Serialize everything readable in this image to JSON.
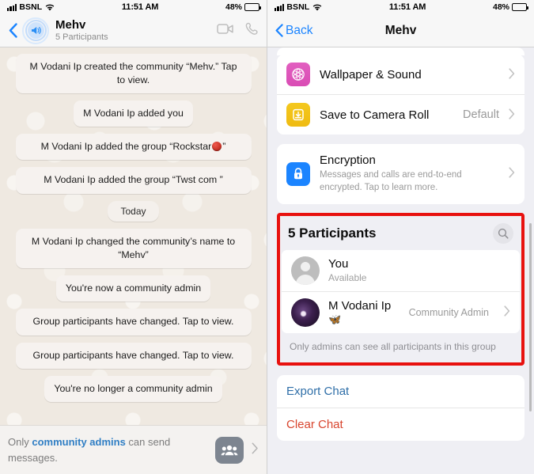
{
  "status_bar": {
    "carrier": "BSNL",
    "time": "11:51 AM",
    "battery_pct": "48%",
    "signal_icon": "signal-bars-icon",
    "wifi_icon": "wifi-icon",
    "battery_icon": "battery-icon"
  },
  "left_panel": {
    "header": {
      "back_icon": "back-chevron-icon",
      "avatar_icon": "community-announcement-icon",
      "title": "Mehv",
      "subtitle": "5 Participants",
      "video_icon": "video-call-icon",
      "phone_icon": "voice-call-icon"
    },
    "messages": [
      {
        "id": "m1",
        "text": "M Vodani Ip created the community “Mehv.” Tap to view.",
        "type": "system",
        "wide": true
      },
      {
        "id": "m2",
        "text": "M Vodani Ip added you",
        "type": "system",
        "wide": false
      },
      {
        "id": "m3",
        "text": "M Vodani Ip added the group “Rockstar",
        "text_after": "”",
        "type": "system-emoji",
        "emoji": "red-circle-emoji",
        "wide": true
      },
      {
        "id": "m4",
        "text": "M Vodani Ip added the group “Twst com ”",
        "type": "system",
        "wide": true
      },
      {
        "id": "d1",
        "text": "Today",
        "type": "day-divider",
        "wide": false
      },
      {
        "id": "m5",
        "text": "M Vodani Ip changed the community’s name to “Mehv”",
        "type": "system",
        "wide": true
      },
      {
        "id": "m6",
        "text": "You're now a community admin",
        "type": "system",
        "wide": false
      },
      {
        "id": "m7",
        "text": "Group participants have changed. Tap to view.",
        "type": "system",
        "wide": true
      },
      {
        "id": "m8",
        "text": "Group participants have changed. Tap to view.",
        "type": "system",
        "wide": true
      },
      {
        "id": "m9",
        "text": "You're no longer a community admin",
        "type": "system",
        "wide": false
      }
    ],
    "footer": {
      "text_before": "Only ",
      "link_text": "community admins",
      "text_after": " can send messages.",
      "community_icon": "community-group-icon",
      "chevron_icon": "chevron-right-icon"
    }
  },
  "right_panel": {
    "header": {
      "back_label": "Back",
      "back_icon": "back-chevron-icon",
      "title": "Mehv"
    },
    "settings": [
      {
        "label": "Wallpaper & Sound",
        "value": "",
        "icon": "wallpaper-sound-icon",
        "icon_color": "#dd4fb6",
        "chevron": "chevron-right-icon"
      },
      {
        "label": "Save to Camera Roll",
        "value": "Default",
        "icon": "save-camera-roll-icon",
        "icon_color": "#f2c015",
        "chevron": "chevron-right-icon"
      }
    ],
    "encryption": {
      "title": "Encryption",
      "subtitle": "Messages and calls are end-to-end encrypted. Tap to learn more.",
      "icon": "lock-icon",
      "icon_color": "#1b84ff",
      "chevron": "chevron-right-icon"
    },
    "participants_section": {
      "highlight_color": "#e8110f",
      "heading": "5 Participants",
      "search_icon": "search-icon",
      "people": [
        {
          "name": "You",
          "status": "Available",
          "badge": "",
          "avatar": "default-person-avatar",
          "has_chevron": false
        },
        {
          "name": "M Vodani Ip",
          "status": "🦋",
          "status_icon": "butterfly-emoji",
          "badge": "Community Admin",
          "avatar": "user-photo-avatar",
          "has_chevron": true
        }
      ],
      "note": "Only admins can see all participants in this group"
    },
    "actions": [
      {
        "label": "Export Chat",
        "color": "#2f6fa8",
        "name": "export-chat"
      },
      {
        "label": "Clear Chat",
        "color": "#d8452e",
        "name": "clear-chat"
      }
    ]
  }
}
